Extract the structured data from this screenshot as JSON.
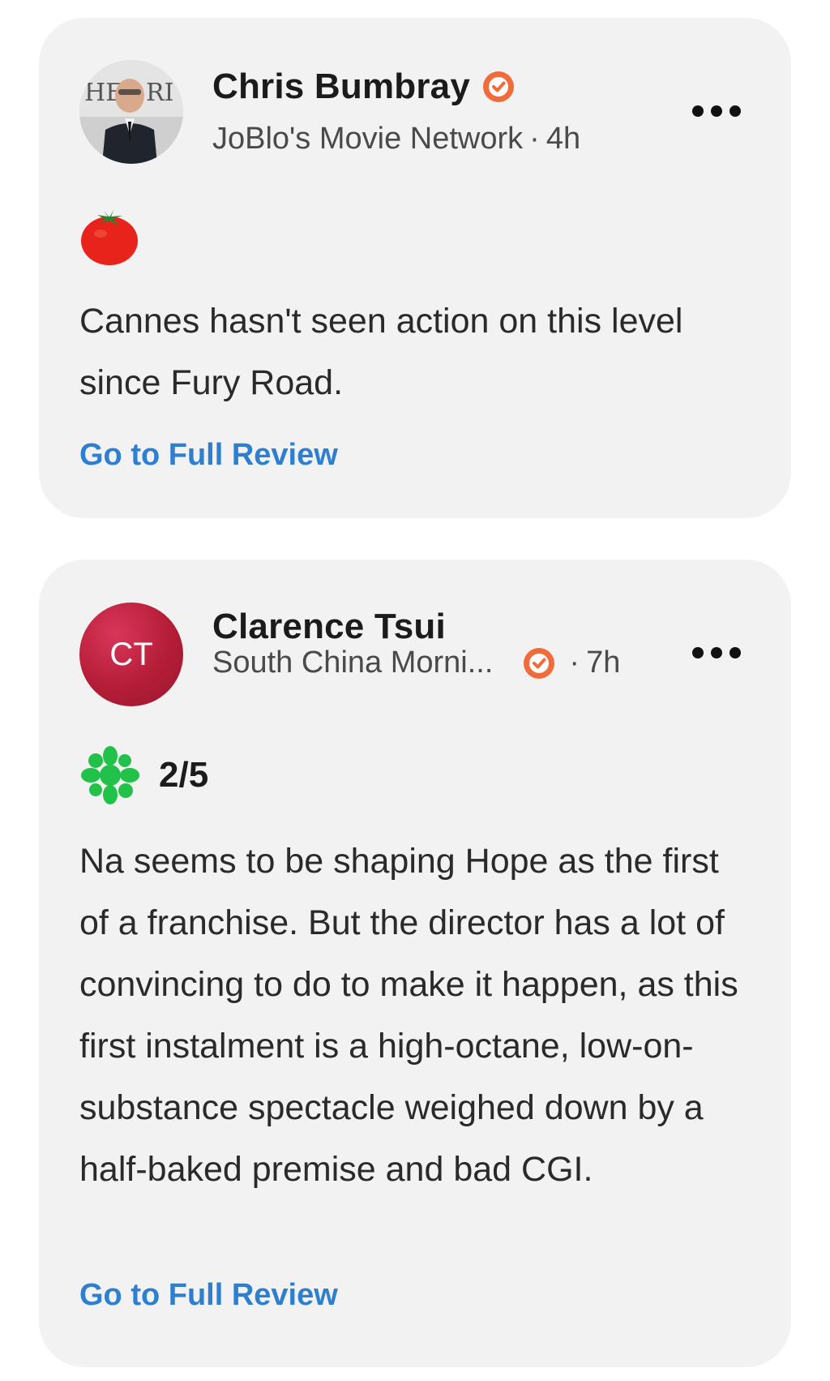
{
  "reviews": [
    {
      "critic_name": "Chris Bumbray",
      "publication": "JoBlo's Movie Network",
      "time_ago": "4h",
      "separator": "·",
      "verified": true,
      "avatar_type": "photo",
      "score_icon": "fresh-tomato-icon",
      "score_text": "",
      "quote": "Cannes hasn't seen action on this level since Fury Road.",
      "link_label": "Go to Full Review"
    },
    {
      "critic_name": "Clarence Tsui",
      "publication": "South China Morni...",
      "time_ago": "7h",
      "separator": "·",
      "verified": true,
      "avatar_type": "initials",
      "avatar_initials": "CT",
      "score_icon": "rotten-splat-icon",
      "score_text": "2/5",
      "quote": "Na seems to be shaping Hope as the first of a franchise. But the director has a lot of convincing to do to make it happen, as this first instalment is a high-octane, low-on-substance spectacle weighed down by a half-baked premise and bad CGI.",
      "link_label": "Go to Full Review"
    }
  ],
  "colors": {
    "card_background": "#f2f2f2",
    "link": "#2e7fd0",
    "verified_badge": "#f26b3a",
    "tomato_red": "#e8231c",
    "splat_green": "#22c24a",
    "initials_avatar": "#b41d36"
  }
}
